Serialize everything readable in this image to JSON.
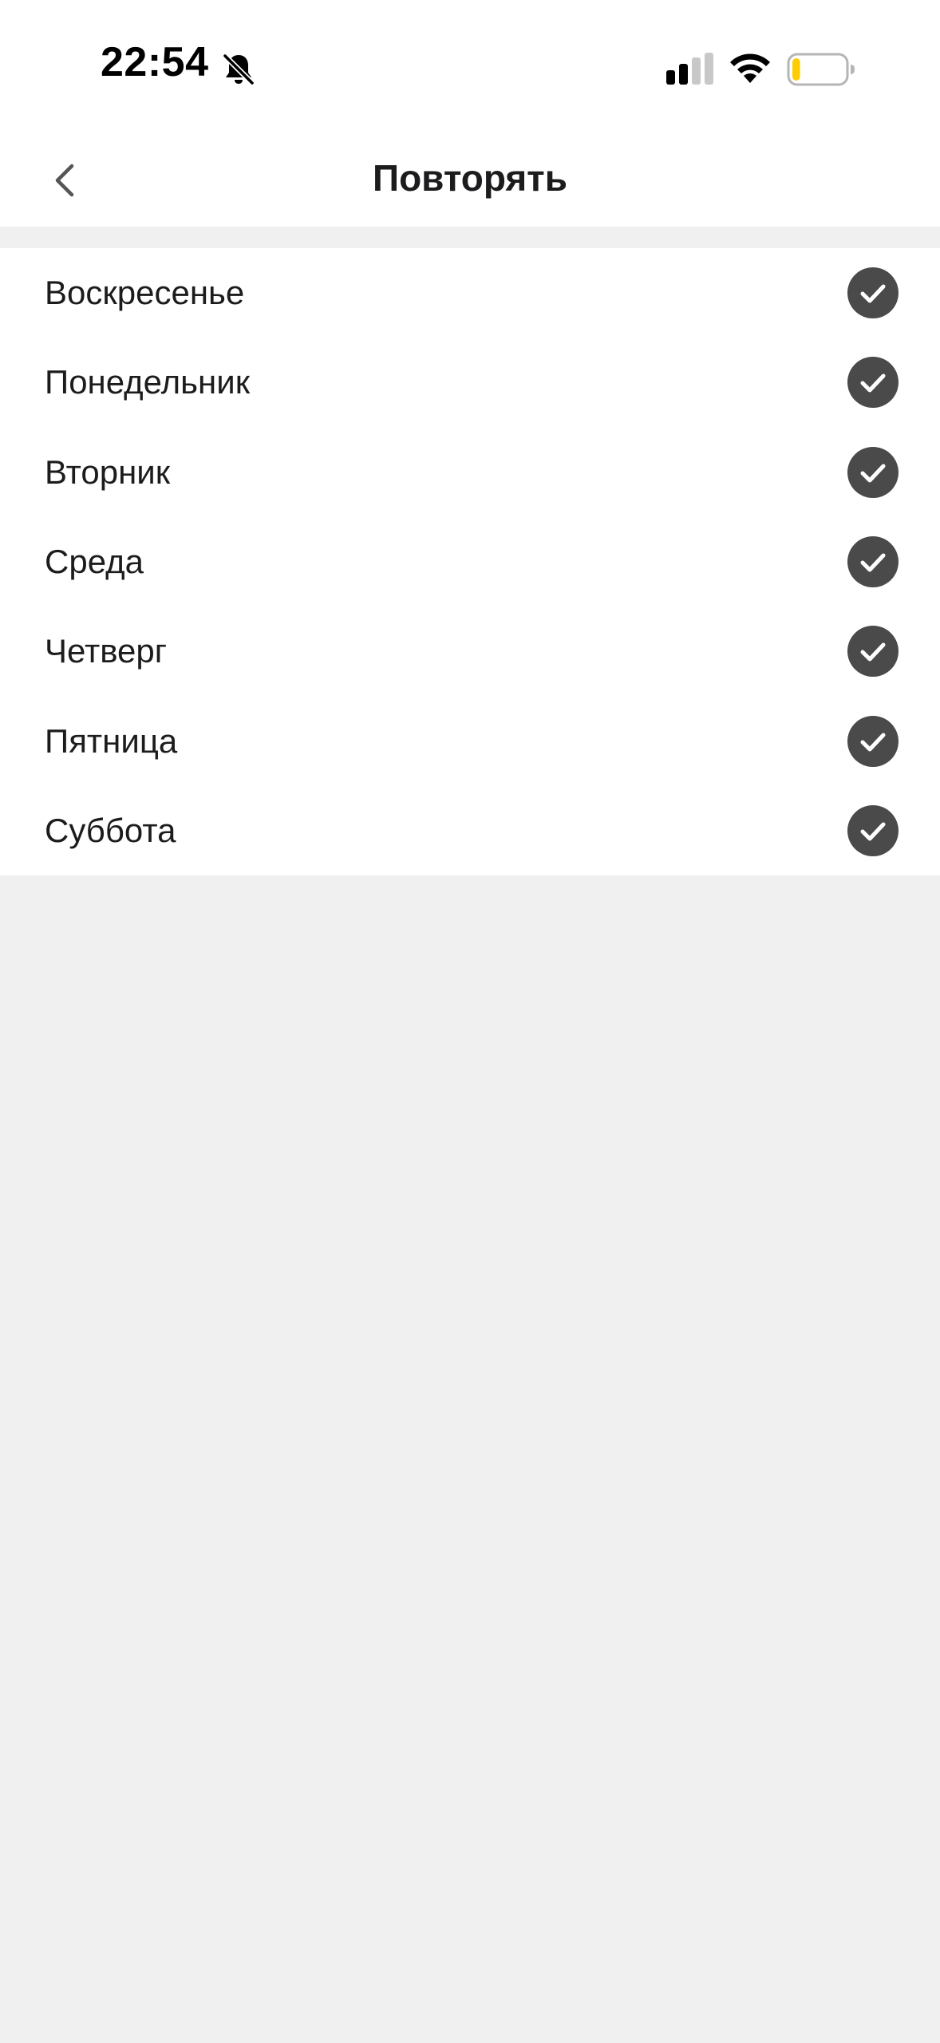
{
  "status_bar": {
    "time": "22:54",
    "icons": [
      "bell-slash-icon",
      "signal-icon",
      "wifi-icon",
      "battery-icon"
    ],
    "battery_level": 0.15,
    "battery_color": "#ffcc00"
  },
  "header": {
    "title": "Повторять",
    "back_icon": "chevron-left-icon"
  },
  "days": [
    {
      "label": "Воскресенье",
      "checked": true
    },
    {
      "label": "Понедельник",
      "checked": true
    },
    {
      "label": "Вторник",
      "checked": true
    },
    {
      "label": "Среда",
      "checked": true
    },
    {
      "label": "Четверг",
      "checked": true
    },
    {
      "label": "Пятница",
      "checked": true
    },
    {
      "label": "Суббота",
      "checked": true
    }
  ],
  "colors": {
    "check_fill": "#4a4a4a",
    "background": "#f0f0f0",
    "surface": "#ffffff"
  }
}
